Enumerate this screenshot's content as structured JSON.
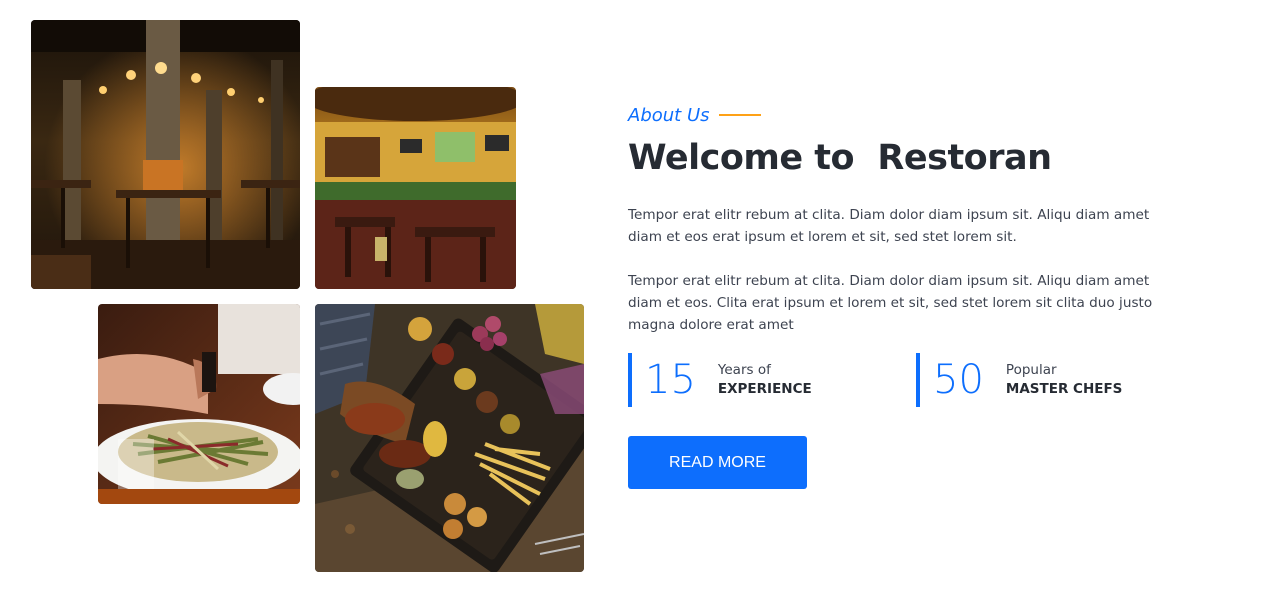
{
  "about": {
    "eyebrow": "About Us",
    "title": "Welcome to  Restoran",
    "paragraphs": [
      "Tempor erat elitr rebum at clita. Diam dolor diam ipsum sit. Aliqu diam amet diam et eos erat ipsum et lorem et sit, sed stet lorem sit.",
      "Tempor erat elitr rebum at clita. Diam dolor diam ipsum sit. Aliqu diam amet diam et eos. Clita erat ipsum et lorem et sit, sed stet lorem sit clita duo justo magna dolore erat amet"
    ]
  },
  "stats": [
    {
      "number": "15",
      "small": "Years of",
      "big": "EXPERIENCE"
    },
    {
      "number": "50",
      "small": "Popular",
      "big": "MASTER CHEFS"
    }
  ],
  "button": {
    "label": "READ MORE"
  },
  "images": [
    {
      "name": "restaurant-interior-dark"
    },
    {
      "name": "restaurant-interior-bar"
    },
    {
      "name": "salad-dish"
    },
    {
      "name": "food-platter"
    }
  ],
  "colors": {
    "primary": "#0d6efd",
    "accent": "#FEA116",
    "heading": "#262b33",
    "text": "#3d4350"
  }
}
